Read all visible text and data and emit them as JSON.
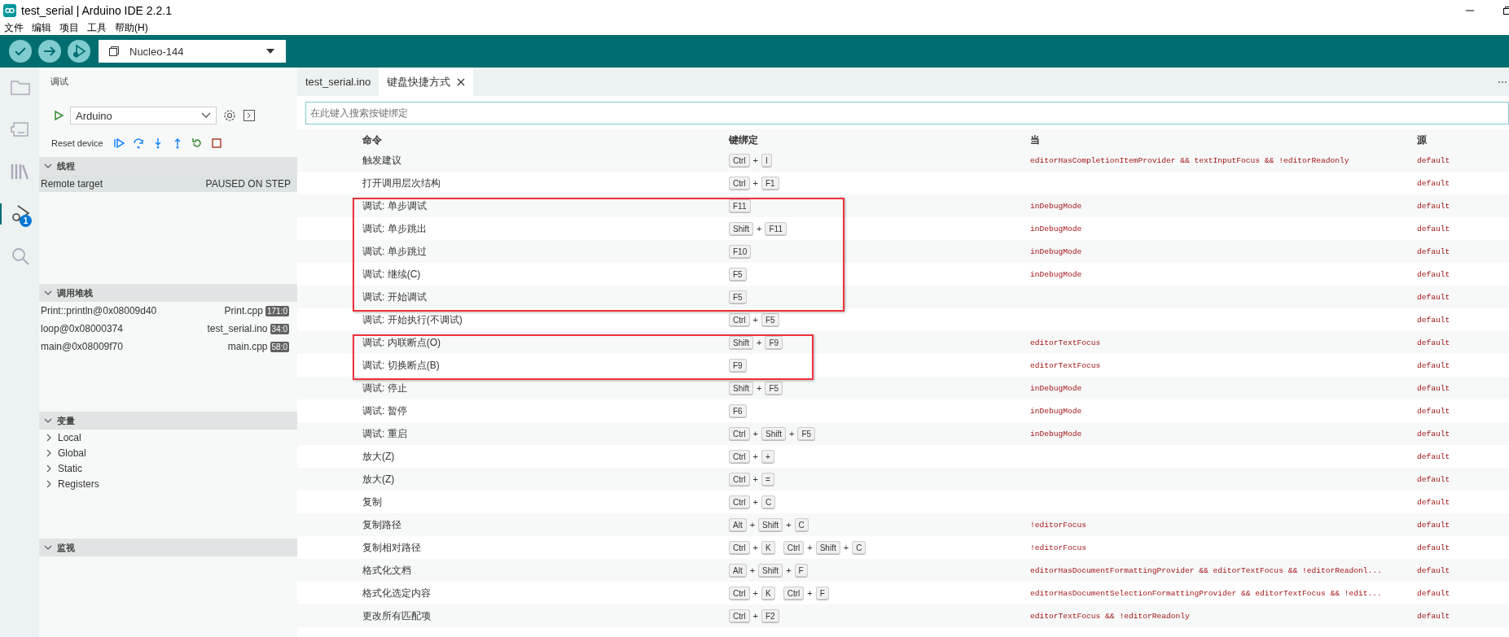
{
  "window": {
    "title": "test_serial | Arduino IDE 2.2.1"
  },
  "menu": [
    "文件",
    "编辑",
    "项目",
    "工具",
    "帮助(H)"
  ],
  "toolbar": {
    "actions": [
      {
        "kind": "verify"
      },
      {
        "kind": "upload"
      },
      {
        "kind": "debug"
      }
    ],
    "board": "Nucleo-144"
  },
  "activity_bar": [
    {
      "kind": "folder",
      "selected": false
    },
    {
      "kind": "board",
      "selected": false
    },
    {
      "kind": "library",
      "selected": false
    },
    {
      "kind": "debug",
      "selected": true,
      "badge": "1"
    },
    {
      "kind": "search",
      "selected": false
    }
  ],
  "side_panel": {
    "title": "调试",
    "configuration": "Arduino",
    "reset_label": "Reset device",
    "debug_actions": [
      {
        "kind": "continue"
      },
      {
        "kind": "step-over"
      },
      {
        "kind": "step-into"
      },
      {
        "kind": "step-out"
      },
      {
        "kind": "restart"
      },
      {
        "kind": "stop"
      }
    ],
    "sections": [
      {
        "kind": "threads",
        "title": "线程",
        "expanded": true,
        "threads": [
          {
            "name": "Remote target",
            "status": "PAUSED ON STEP",
            "selected": true
          }
        ]
      },
      {
        "kind": "call_stack",
        "title": "调用堆栈",
        "expanded": true,
        "frames": [
          {
            "name": "Print::println@0x08009d40",
            "file": "Print.cpp",
            "position": "171:0"
          },
          {
            "name": "loop@0x08000374",
            "file": "test_serial.ino",
            "position": "34:0"
          },
          {
            "name": "main@0x08009f70",
            "file": "main.cpp",
            "position": "58:0"
          }
        ]
      },
      {
        "kind": "variables",
        "title": "变量",
        "expanded": true,
        "items": [
          {
            "label": "Local",
            "expanded": false
          },
          {
            "label": "Global",
            "expanded": false
          },
          {
            "label": "Static",
            "expanded": false
          },
          {
            "label": "Registers",
            "expanded": false
          }
        ]
      },
      {
        "kind": "watch",
        "title": "监视",
        "expanded": true
      }
    ]
  },
  "tabs": [
    {
      "label": "test_serial.ino",
      "selected": false,
      "closable": false
    },
    {
      "label": "键盘快捷方式",
      "selected": true,
      "closable": true
    }
  ],
  "search": {
    "placeholder": "在此键入搜索按键绑定"
  },
  "table": {
    "columns": [
      "命令",
      "键绑定",
      "当",
      "源"
    ],
    "key_separator": "+",
    "rows": [
      {
        "command": "触发建议",
        "keys": [
          [
            "Ctrl",
            "I"
          ]
        ],
        "when": "editorHasCompletionItemProvider && textInputFocus && !editorReadonly",
        "source": "default",
        "marked": false
      },
      {
        "command": "打开调用层次结构",
        "keys": [
          [
            "Ctrl",
            "F1"
          ]
        ],
        "source": "default",
        "marked": false
      },
      {
        "command": "调试: 单步调试",
        "keys": [
          [
            "F11"
          ]
        ],
        "when": "inDebugMode",
        "source": "default",
        "marked": true
      },
      {
        "command": "调试: 单步跳出",
        "keys": [
          [
            "Shift",
            "F11"
          ]
        ],
        "when": "inDebugMode",
        "source": "default",
        "marked": true
      },
      {
        "command": "调试: 单步跳过",
        "keys": [
          [
            "F10"
          ]
        ],
        "when": "inDebugMode",
        "source": "default",
        "marked": true
      },
      {
        "command": "调试: 继续(C)",
        "keys": [
          [
            "F5"
          ]
        ],
        "when": "inDebugMode",
        "source": "default",
        "marked": true
      },
      {
        "command": "调试: 开始调试",
        "keys": [
          [
            "F5"
          ]
        ],
        "source": "default",
        "marked": true
      },
      {
        "command": "调试: 开始执行(不调试)",
        "keys": [
          [
            "Ctrl",
            "F5"
          ]
        ],
        "source": "default",
        "marked": false
      },
      {
        "command": "调试: 内联断点(O)",
        "keys": [
          [
            "Shift",
            "F9"
          ]
        ],
        "when": "editorTextFocus",
        "source": "default",
        "marked": true
      },
      {
        "command": "调试: 切换断点(B)",
        "keys": [
          [
            "F9"
          ]
        ],
        "when": "editorTextFocus",
        "source": "default",
        "marked": true
      },
      {
        "command": "调试: 停止",
        "keys": [
          [
            "Shift",
            "F5"
          ]
        ],
        "when": "inDebugMode",
        "source": "default",
        "marked": false
      },
      {
        "command": "调试: 暂停",
        "keys": [
          [
            "F6"
          ]
        ],
        "when": "inDebugMode",
        "source": "default",
        "marked": false
      },
      {
        "command": "调试: 重启",
        "keys": [
          [
            "Ctrl",
            "Shift",
            "F5"
          ]
        ],
        "when": "inDebugMode",
        "source": "default",
        "marked": false
      },
      {
        "command": "放大(Z)",
        "keys": [
          [
            "Ctrl",
            "+"
          ]
        ],
        "source": "default",
        "marked": false
      },
      {
        "command": "放大(Z)",
        "keys": [
          [
            "Ctrl",
            "="
          ]
        ],
        "source": "default",
        "marked": false
      },
      {
        "command": "复制",
        "keys": [
          [
            "Ctrl",
            "C"
          ]
        ],
        "source": "default",
        "marked": false
      },
      {
        "command": "复制路径",
        "keys": [
          [
            "Alt",
            "Shift",
            "C"
          ]
        ],
        "when": "!editorFocus",
        "source": "default",
        "marked": false
      },
      {
        "command": "复制相对路径",
        "keys": [
          [
            "Ctrl",
            "K"
          ],
          [
            "Ctrl",
            "Shift",
            "C"
          ]
        ],
        "when": "!editorFocus",
        "source": "default",
        "marked": false
      },
      {
        "command": "格式化文档",
        "keys": [
          [
            "Alt",
            "Shift",
            "F"
          ]
        ],
        "when": "editorHasDocumentFormattingProvider && editorTextFocus && !editorReadonl...",
        "source": "default",
        "marked": false
      },
      {
        "command": "格式化选定内容",
        "keys": [
          [
            "Ctrl",
            "K"
          ],
          [
            "Ctrl",
            "F"
          ]
        ],
        "when": "editorHasDocumentSelectionFormattingProvider && editorTextFocus && !edit...",
        "source": "default",
        "marked": false
      },
      {
        "command": "更改所有匹配项",
        "keys": [
          [
            "Ctrl",
            "F2"
          ]
        ],
        "when": "editorTextFocus && !editorReadonly",
        "source": "default",
        "marked": false
      }
    ]
  }
}
